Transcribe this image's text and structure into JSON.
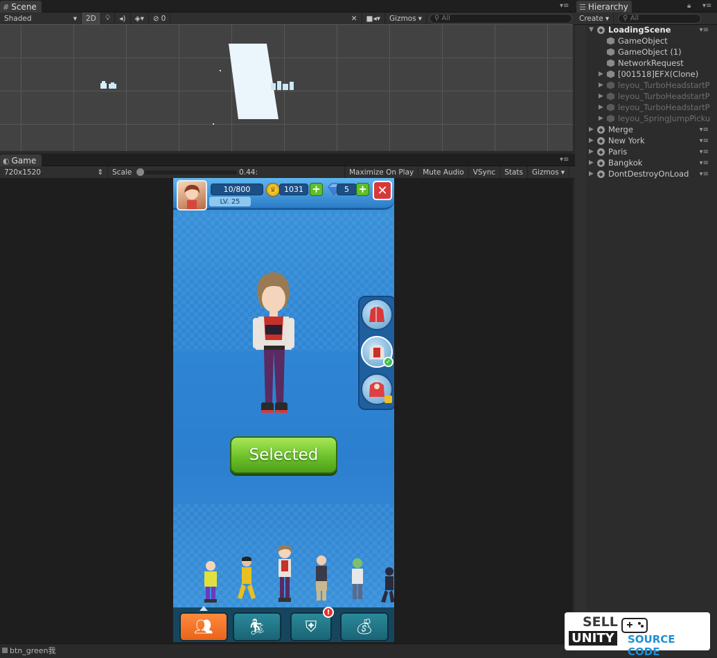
{
  "scene": {
    "tab_label": "Scene",
    "shading_mode": "Shaded",
    "mode_2d": "2D",
    "effects_count": "0",
    "gizmos_label": "Gizmos",
    "search_placeholder": "All"
  },
  "game": {
    "tab_label": "Game",
    "resolution": "720x1520",
    "scale_label": "Scale",
    "scale_value": "0.44:",
    "toggles": [
      "Maximize On Play",
      "Mute Audio",
      "VSync",
      "Stats",
      "Gizmos"
    ]
  },
  "game_ui": {
    "energy": "10/800",
    "level": "LV. 25",
    "coins": "1031",
    "gems": "5",
    "select_button": "Selected",
    "bottom_badge": "!"
  },
  "hierarchy": {
    "tab_label": "Hierarchy",
    "create_label": "Create",
    "search_placeholder": "All",
    "items": [
      {
        "label": "LoadingScene",
        "type": "scene"
      },
      {
        "label": "GameObject",
        "type": "object"
      },
      {
        "label": "GameObject (1)",
        "type": "object"
      },
      {
        "label": "NetworkRequest",
        "type": "object"
      },
      {
        "label": "[001518]EFX(Clone)",
        "type": "object"
      },
      {
        "label": "leyou_TurboHeadstartP",
        "type": "object-inactive"
      },
      {
        "label": "leyou_TurboHeadstartP",
        "type": "object-inactive"
      },
      {
        "label": "leyou_TurboHeadstartP",
        "type": "object-inactive"
      },
      {
        "label": "leyou_SpringJumpPicku",
        "type": "object-inactive"
      },
      {
        "label": "Merge",
        "type": "scene"
      },
      {
        "label": "New York",
        "type": "scene"
      },
      {
        "label": "Paris",
        "type": "scene"
      },
      {
        "label": "Bangkok",
        "type": "scene"
      },
      {
        "label": "DontDestroyOnLoad",
        "type": "scene"
      }
    ]
  },
  "status_bar": {
    "message": "btn_green我"
  },
  "watermark": {
    "line1": "SELL",
    "line2": "UNITY",
    "line3": "SOURCE CODE"
  },
  "colors": {
    "accent_green": "#5fbf28",
    "close_red": "#d8383a",
    "active_tab_orange": "#e8641c"
  }
}
